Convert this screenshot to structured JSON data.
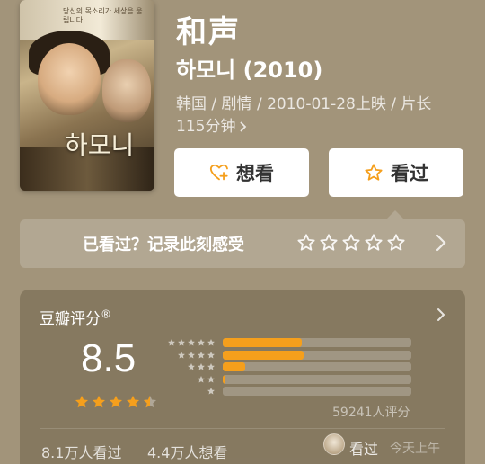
{
  "movie": {
    "title": "和声",
    "original_title": "하모니 (2010)",
    "meta_line": "韩国 / 剧情 / 2010-01-28上映 / 片长 115分钟",
    "poster_title_art": "하모니",
    "poster_tagline": "당신의 목소리가 세상을 울립니다"
  },
  "actions": {
    "want_label": "想看",
    "seen_label": "看过"
  },
  "record": {
    "prompt": "已看过？记录此刻感受",
    "star_count": 5
  },
  "rating": {
    "label": "豆瓣评分",
    "label_mark": "®",
    "score": "8.5",
    "score_stars": 4.5,
    "distribution": [
      {
        "stars": 5,
        "fraction": 0.42
      },
      {
        "stars": 4,
        "fraction": 0.43
      },
      {
        "stars": 3,
        "fraction": 0.12
      },
      {
        "stars": 2,
        "fraction": 0.01
      },
      {
        "stars": 1,
        "fraction": 0.0
      }
    ],
    "count_text": "59241人评分",
    "seen_count": "8.1万人看过",
    "want_count": "4.4万人想看",
    "friend_action": "看过",
    "friend_time": "今天上午"
  },
  "colors": {
    "background": "#a2947a",
    "accent": "#f59f1c",
    "button_bg": "#ffffff"
  }
}
